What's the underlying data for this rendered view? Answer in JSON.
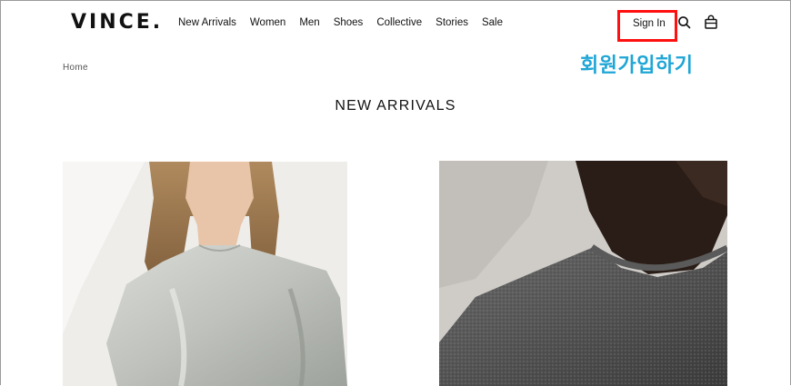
{
  "header": {
    "logo": "VINCE.",
    "nav": [
      "New Arrivals",
      "Women",
      "Men",
      "Shoes",
      "Collective",
      "Stories",
      "Sale"
    ],
    "sign_in": "Sign In",
    "icons": [
      "search-icon",
      "bag-icon"
    ]
  },
  "annotation": "회원가입하기",
  "breadcrumb": "Home",
  "page_title": "NEW ARRIVALS",
  "products": [
    {
      "image": "woman-silver-satin-top"
    },
    {
      "image": "man-grey-knit-sweater"
    }
  ],
  "colors": {
    "highlight": "#ff1010",
    "annotation": "#1fa6d6"
  }
}
